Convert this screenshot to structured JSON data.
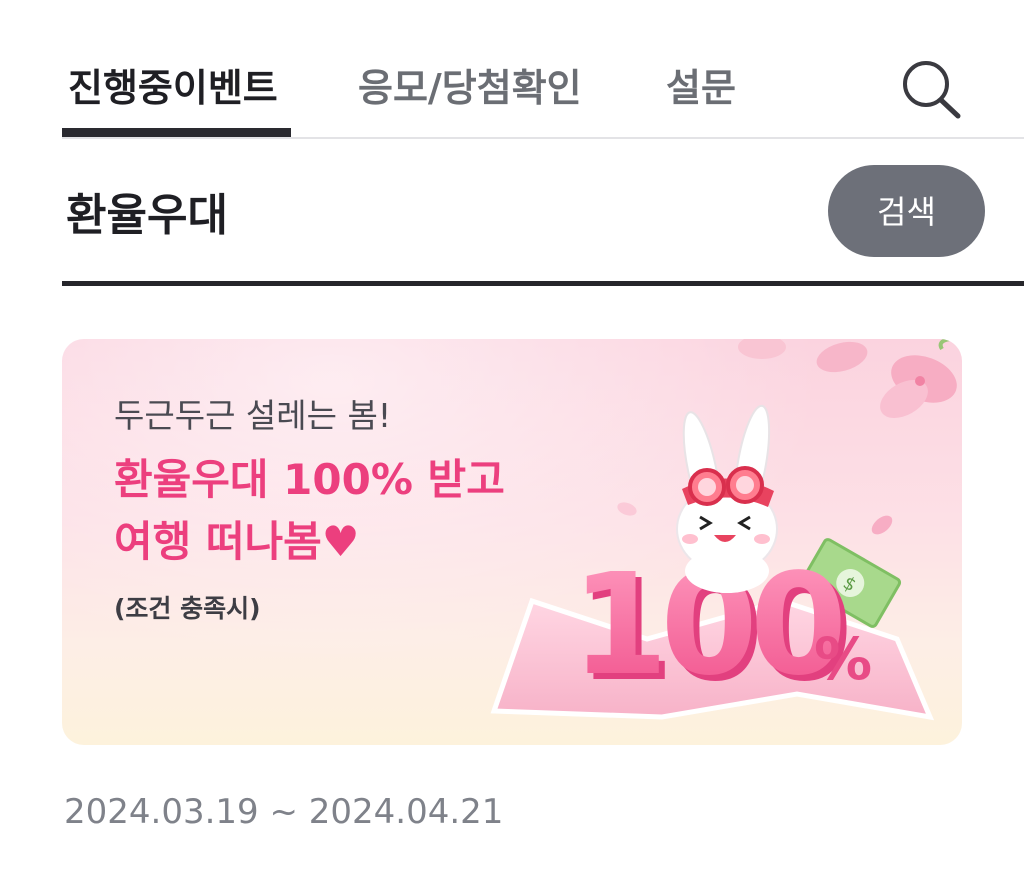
{
  "tabs": [
    {
      "label": "진행중이벤트",
      "active": true
    },
    {
      "label": "응모/당첨확인",
      "active": false
    },
    {
      "label": "설문",
      "active": false
    }
  ],
  "search_icon": "search-icon",
  "category": {
    "title": "환율우대",
    "search_button_label": "검색"
  },
  "event": {
    "eyebrow": "두근두근 설레는 봄!",
    "headline_line1": "환율우대 100% 받고",
    "headline_line2": "여행 떠나봄♥",
    "note": "(조건 충족시)",
    "badge_number": "100",
    "badge_unit": "%",
    "date_range": "2024.03.19 ~ 2024.04.21"
  },
  "colors": {
    "active_tab": "#1f1f24",
    "inactive_tab": "#6b6e74",
    "search_button_bg": "#6d7079",
    "headline_pink": "#ec3f7e",
    "date_gray": "#7f828a"
  }
}
